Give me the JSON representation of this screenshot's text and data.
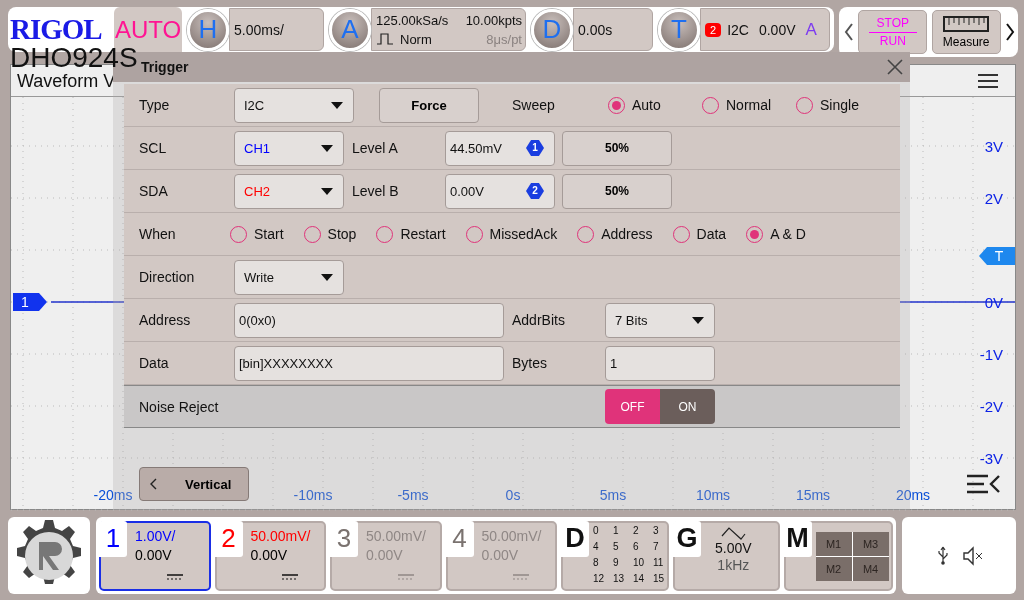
{
  "top_bar": {
    "logo": "RIGOL",
    "model": "DHO924S",
    "mode": "AUTO",
    "horizontal": {
      "key": "H",
      "scale": "5.00ms/"
    },
    "acquire": {
      "key": "A",
      "sample_rate": "125.00kSa/s",
      "memory_depth": "10.00kpts",
      "mode": "Norm",
      "resolution": "8μs/pt"
    },
    "delay": {
      "key": "D",
      "value": "0.00s"
    },
    "trigger": {
      "key": "T",
      "source": "2",
      "type": "I2C",
      "level": "0.00V",
      "slope": "A"
    },
    "run_control": {
      "stop": "STOP",
      "run": "RUN"
    },
    "measure": "Measure"
  },
  "waveform_view": {
    "title": "Waveform V",
    "y_labels": [
      "3V",
      "2V",
      "0V",
      "-1V",
      "-2V",
      "-3V"
    ],
    "x_labels": [
      "-20ms",
      "-10ms",
      "-5ms",
      "0s",
      "5ms",
      "10ms",
      "15ms",
      "20ms"
    ],
    "channel_marker": "1",
    "trigger_marker": "T"
  },
  "trigger_dialog": {
    "title": "Trigger",
    "type": {
      "label": "Type",
      "value": "I2C"
    },
    "force": "Force",
    "sweep": {
      "label": "Sweep",
      "options": [
        {
          "label": "Auto",
          "selected": true
        },
        {
          "label": "Normal",
          "selected": false
        },
        {
          "label": "Single",
          "selected": false
        }
      ]
    },
    "scl": {
      "label": "SCL",
      "value": "CH1",
      "color": "#0000ff"
    },
    "level_a": {
      "label": "Level A",
      "value": "44.50mV",
      "badge": "1",
      "half": "50%"
    },
    "sda": {
      "label": "SDA",
      "value": "CH2",
      "color": "#ff0000"
    },
    "level_b": {
      "label": "Level B",
      "value": "0.00V",
      "badge": "2",
      "half": "50%"
    },
    "when": {
      "label": "When",
      "options": [
        {
          "label": "Start",
          "selected": false
        },
        {
          "label": "Stop",
          "selected": false
        },
        {
          "label": "Restart",
          "selected": false
        },
        {
          "label": "MissedAck",
          "selected": false
        },
        {
          "label": "Address",
          "selected": false
        },
        {
          "label": "Data",
          "selected": false
        },
        {
          "label": "A & D",
          "selected": true
        }
      ]
    },
    "direction": {
      "label": "Direction",
      "value": "Write"
    },
    "address": {
      "label": "Address",
      "value": "0(0x0)"
    },
    "addr_bits": {
      "label": "AddrBits",
      "value": "7 Bits"
    },
    "data": {
      "label": "Data",
      "value": "[bin]XXXXXXXX"
    },
    "bytes": {
      "label": "Bytes",
      "value": "1"
    },
    "noise_reject": {
      "label": "Noise Reject",
      "options": [
        {
          "label": "OFF",
          "selected": true
        },
        {
          "label": "ON",
          "selected": false
        }
      ]
    },
    "back": "Vertical"
  },
  "channels": [
    {
      "number": "1",
      "scale": "1.00V/",
      "offset": "0.00V",
      "color": "#0000ff",
      "enabled": true,
      "selected": true
    },
    {
      "number": "2",
      "scale": "50.00mV/",
      "offset": "0.00V",
      "color": "#ff0000",
      "enabled": true,
      "selected": false
    },
    {
      "number": "3",
      "scale": "50.00mV/",
      "offset": "0.00V",
      "enabled": false,
      "selected": false
    },
    {
      "number": "4",
      "scale": "50.00mV/",
      "offset": "0.00V",
      "enabled": false,
      "selected": false
    }
  ],
  "digital": {
    "key": "D",
    "bits": [
      "0",
      "1",
      "2",
      "3",
      "4",
      "5",
      "6",
      "7",
      "8",
      "9",
      "10",
      "11",
      "12",
      "13",
      "14",
      "15"
    ]
  },
  "generator": {
    "key": "G",
    "amplitude": "5.00V",
    "frequency": "1kHz"
  },
  "math": {
    "key": "M",
    "items": [
      "M1",
      "M3",
      "M2",
      "M4"
    ]
  }
}
